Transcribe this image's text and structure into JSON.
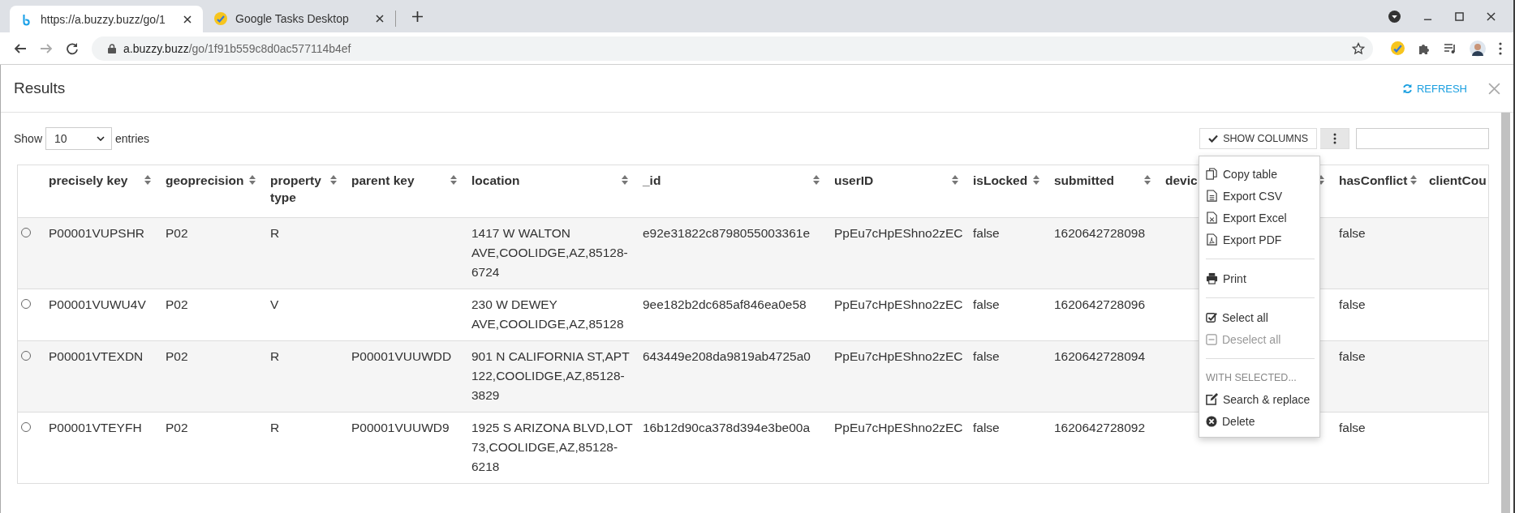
{
  "browser": {
    "tabs": [
      {
        "title": "https://a.buzzy.buzz/go/1",
        "selected": true
      },
      {
        "title": "Google Tasks Desktop",
        "selected": false
      }
    ],
    "address": {
      "host": "a.buzzy.buzz",
      "path": "/go/1f91b559c8d0ac577114b4ef"
    }
  },
  "dialog": {
    "title": "Results",
    "refresh_label": "REFRESH"
  },
  "length_menu": {
    "show_label": "Show",
    "value": "10",
    "entries_label": "entries"
  },
  "toolbar": {
    "show_columns_label": "SHOW COLUMNS"
  },
  "table": {
    "columns": [
      "precisely key",
      "geoprecision",
      "property type",
      "parent key",
      "location",
      "_id",
      "userID",
      "isLocked",
      "submitted",
      "devic",
      "hasConflict",
      "clientCou"
    ],
    "rows": [
      {
        "selected": false,
        "cells": [
          "P00001VUPSHR",
          "P02",
          "R",
          null,
          "1417 W WALTON AVE,COOLIDGE,AZ,85128-6724",
          "e92e31822c8798055003361e",
          "PpEu7cHpEShno2zEC",
          "false",
          "1620642728098",
          null,
          "false"
        ]
      },
      {
        "selected": false,
        "cells": [
          "P00001VUWU4V",
          "P02",
          "V",
          null,
          "230 W DEWEY AVE,COOLIDGE,AZ,85128",
          "9ee182b2dc685af846ea0e58",
          "PpEu7cHpEShno2zEC",
          "false",
          "1620642728096",
          null,
          "false"
        ]
      },
      {
        "selected": false,
        "cells": [
          "P00001VTEXDN",
          "P02",
          "R",
          "P00001VUUWDD",
          "901 N CALIFORNIA ST,APT 122,COOLIDGE,AZ,85128-3829",
          "643449e208da9819ab4725a0",
          "PpEu7cHpEShno2zEC",
          "false",
          "1620642728094",
          null,
          "false"
        ]
      },
      {
        "selected": false,
        "cells": [
          "P00001VTEYFH",
          "P02",
          "R",
          "P00001VUUWD9",
          "1925 S ARIZONA BLVD,LOT 73,COOLIDGE,AZ,85128-6218",
          "16b12d90ca378d394e3be00a",
          "PpEu7cHpEShno2zEC",
          "false",
          "1620642728092",
          null,
          "false"
        ]
      }
    ]
  },
  "menu": {
    "items": [
      {
        "kind": "item",
        "label": "Copy table",
        "disabled": false
      },
      {
        "kind": "item",
        "label": "Export CSV",
        "disabled": false
      },
      {
        "kind": "item",
        "label": "Export Excel",
        "disabled": false
      },
      {
        "kind": "item",
        "label": "Export PDF",
        "disabled": false
      },
      {
        "kind": "divider"
      },
      {
        "kind": "item",
        "label": "Print",
        "disabled": false
      },
      {
        "kind": "divider"
      },
      {
        "kind": "item",
        "label": "Select all",
        "disabled": false
      },
      {
        "kind": "item",
        "label": "Deselect all",
        "disabled": true
      },
      {
        "kind": "divider"
      },
      {
        "kind": "header",
        "label": "WITH SELECTED..."
      },
      {
        "kind": "item",
        "label": "Search & replace",
        "disabled": false
      },
      {
        "kind": "item",
        "label": "Delete",
        "disabled": false
      }
    ]
  }
}
